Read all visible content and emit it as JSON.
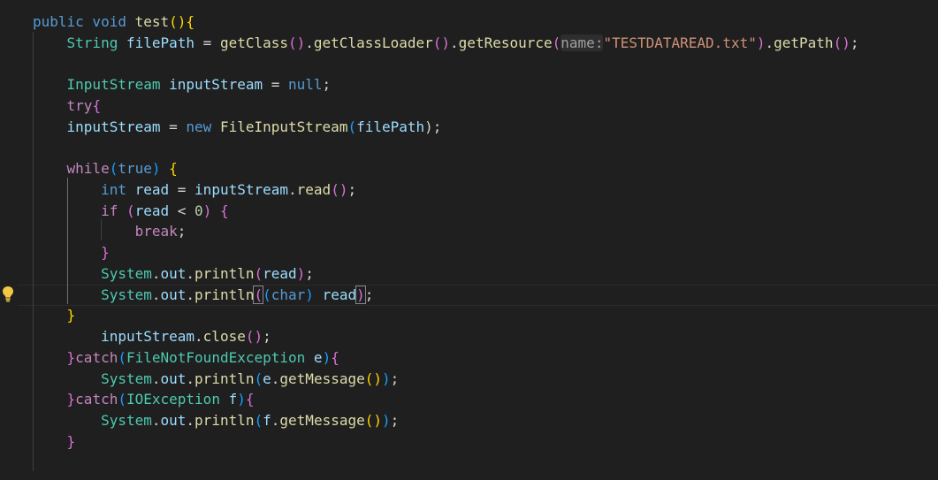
{
  "code": {
    "l1": [
      "public void ",
      "test",
      "()",
      "{"
    ],
    "l2": [
      "String",
      " ",
      "filePath",
      " = ",
      "getClass",
      "()",
      ".",
      "getClassLoader",
      "()",
      ".",
      "getResource",
      "(",
      "name:",
      "\"TESTDATAREAD.txt\"",
      ")",
      ".",
      "getPath",
      "()",
      ";"
    ],
    "l3": [
      "InputStream",
      " ",
      "inputStream",
      " = ",
      "null",
      ";"
    ],
    "l4": [
      "try",
      "{"
    ],
    "l5": [
      "inputStream",
      " = ",
      "new",
      " ",
      "FileInputStream",
      "(",
      "filePath",
      ");"
    ],
    "l6": [
      "while",
      "(",
      "true",
      ")",
      " ",
      "{"
    ],
    "l7": [
      "int",
      " ",
      "read",
      " = ",
      "inputStream",
      ".",
      "read",
      "()",
      ";"
    ],
    "l8": [
      "if",
      " ",
      "(",
      "read",
      " < ",
      "0",
      ")",
      " ",
      "{"
    ],
    "l9": [
      "break",
      ";"
    ],
    "l10": [
      "}"
    ],
    "l11": [
      "System",
      ".",
      "out",
      ".",
      "println",
      "(",
      "read",
      ")",
      ";"
    ],
    "l12": [
      "System",
      ".",
      "out",
      ".",
      "println",
      "(",
      "(",
      "char",
      ")",
      " ",
      "read",
      ")",
      ";"
    ],
    "l13": [
      "}"
    ],
    "l14": [
      "inputStream",
      ".",
      "close",
      "()",
      ";"
    ],
    "l15": [
      "}",
      "catch",
      "(",
      "FileNotFoundException",
      " ",
      "e",
      ")",
      "{"
    ],
    "l16": [
      "System",
      ".",
      "out",
      ".",
      "println",
      "(",
      "e",
      ".",
      "getMessage",
      "()",
      ")",
      ";"
    ],
    "l17": [
      "}",
      "catch",
      "(",
      "IOException",
      " ",
      "f",
      ")",
      "{"
    ],
    "l18": [
      "System",
      ".",
      "out",
      ".",
      "println",
      "(",
      "f",
      ".",
      "getMessage",
      "()",
      ")",
      ";"
    ],
    "l19": [
      "}"
    ]
  },
  "icons": {
    "lightbulb": "lightbulb-icon"
  },
  "colors": {
    "background": "#1f1f1f",
    "keyword": "#569cd6",
    "control": "#c586c0",
    "type": "#4ec9b0",
    "variable": "#9cdcfe",
    "function": "#dcdcaa",
    "string": "#ce9178",
    "number": "#b5cea8",
    "lightbulb": "#f0c846"
  }
}
